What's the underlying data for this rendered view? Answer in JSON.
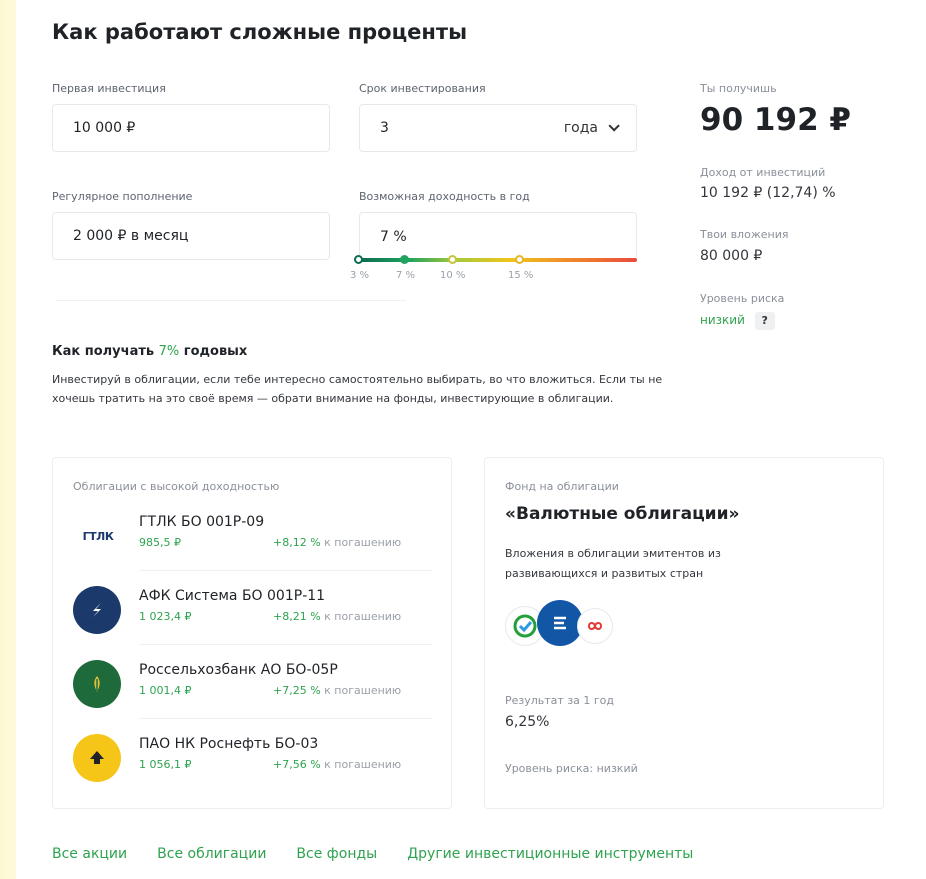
{
  "title": "Как работают сложные проценты",
  "inputs": {
    "first_investment": {
      "label": "Первая инвестиция",
      "value": "10 000 ₽"
    },
    "term": {
      "label": "Срок инвестирования",
      "value": "3",
      "unit": "года"
    },
    "regular": {
      "label": "Регулярное пополнение",
      "value": "2 000 ₽ в месяц"
    },
    "yield": {
      "label": "Возможная доходность в год",
      "value": "7 %",
      "ticks": [
        "3 %",
        "7 %",
        "10 %",
        "15 %"
      ],
      "selected_index": 1
    }
  },
  "result": {
    "you_get_label": "Ты получишь",
    "you_get_value": "90 192 ₽",
    "income_label": "Доход от инвестиций",
    "income_value": "10 192 ₽ (12,74) %",
    "contrib_label": "Твои вложения",
    "contrib_value": "80 000 ₽",
    "risk_label": "Уровень риска",
    "risk_value": "низкий",
    "risk_help": "?"
  },
  "how": {
    "title_prefix": "Как получать ",
    "title_percent": "7%",
    "title_suffix": " годовых",
    "text": "Инвестируй в облигации, если тебе интересно самостоятельно выбирать, во что вложиться. Если ты не хочешь тратить на это своё время — обрати внимание на фонды, инвестирующие в облигации."
  },
  "bonds": {
    "header": "Облигации с высокой доходностью",
    "items": [
      {
        "name": "ГТЛК БО 001Р-09",
        "price": "985,5 ₽",
        "yield": "+8,12 %",
        "yield_suffix": " к погашению",
        "logo": "gtlk-logo",
        "logo_text": "ГТЛК"
      },
      {
        "name": "АФК Система БО 001Р-11",
        "price": "1 023,4 ₽",
        "yield": "+8,21 %",
        "yield_suffix": " к погашению",
        "logo": "sistema-logo"
      },
      {
        "name": "Россельхозбанк АО БО-05Р",
        "price": "1 001,4 ₽",
        "yield": "+7,25 %",
        "yield_suffix": " к погашению",
        "logo": "rshb-logo"
      },
      {
        "name": "ПАО НК Роснефть БО-03",
        "price": "1 056,1 ₽",
        "yield": "+7,56 %",
        "yield_suffix": " к погашению",
        "logo": "rosneft-logo"
      }
    ]
  },
  "fund": {
    "header": "Фонд на облигации",
    "name": "«Валютные облигации»",
    "desc": "Вложения в облигации эмитентов из развивающихся и развитых стран",
    "result_label": "Результат за 1 год",
    "result_value": "6,25%",
    "risk": "Уровень риска: низкий"
  },
  "links": [
    "Все акции",
    "Все облигации",
    "Все фонды",
    "Другие инвестиционные инструменты"
  ],
  "colors": {
    "accent": "#2fa34f",
    "accent_dark": "#0c6b50",
    "afk": "#1b3a6b",
    "rshb": "#1f6a3a",
    "rosneft": "#f5c518"
  }
}
